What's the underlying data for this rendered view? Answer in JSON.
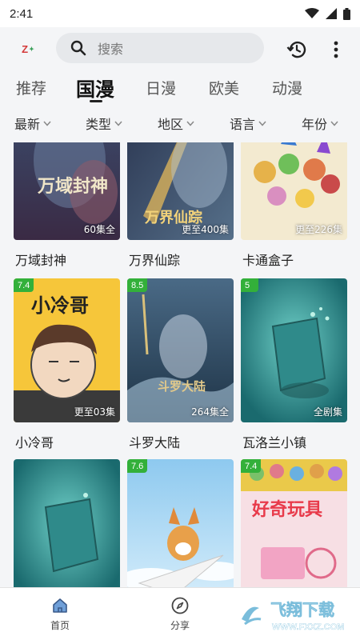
{
  "status": {
    "time": "2:41"
  },
  "header": {
    "logo_text": "Z",
    "search_placeholder": "搜索",
    "icons": [
      "search-icon",
      "history-icon",
      "more-vert-icon"
    ]
  },
  "tabs": [
    {
      "label": "推荐",
      "active": false
    },
    {
      "label": "国漫",
      "active": true
    },
    {
      "label": "日漫",
      "active": false
    },
    {
      "label": "欧美",
      "active": false
    },
    {
      "label": "动漫",
      "active": false
    }
  ],
  "filters": [
    {
      "label": "最新"
    },
    {
      "label": "类型"
    },
    {
      "label": "地区"
    },
    {
      "label": "语言"
    },
    {
      "label": "年份"
    }
  ],
  "cards": [
    {
      "title": "万域封神",
      "episodes": "60集全",
      "rating": "",
      "poster_text": "万域封神"
    },
    {
      "title": "万界仙踪",
      "episodes": "更至400集",
      "rating": "",
      "poster_text": "万界仙踪"
    },
    {
      "title": "卡通盒子",
      "episodes": "更至226集",
      "rating": "",
      "poster_text": ""
    },
    {
      "title": "小冷哥",
      "episodes": "更至03集",
      "rating": "7.4",
      "poster_text": "小冷哥"
    },
    {
      "title": "斗罗大陆",
      "episodes": "264集全",
      "rating": "8.5",
      "poster_text": "斗罗大陆"
    },
    {
      "title": "瓦洛兰小镇",
      "episodes": "全剧集",
      "rating": "5",
      "poster_text": ""
    },
    {
      "title": "",
      "episodes": "",
      "rating": "",
      "poster_text": ""
    },
    {
      "title": "",
      "episodes": "",
      "rating": "7.6",
      "poster_text": ""
    },
    {
      "title": "",
      "episodes": "",
      "rating": "7.4",
      "poster_text": "好奇玩具"
    }
  ],
  "bottom_nav": [
    {
      "label": "首页",
      "icon": "home-icon",
      "active": true
    },
    {
      "label": "分享",
      "icon": "compass-icon",
      "active": false
    }
  ],
  "watermark": {
    "text": "飞翔下载",
    "url": "WWW.FXXZ.COM"
  },
  "colors": {
    "badge": "#33b03a",
    "accent": "#111111"
  }
}
